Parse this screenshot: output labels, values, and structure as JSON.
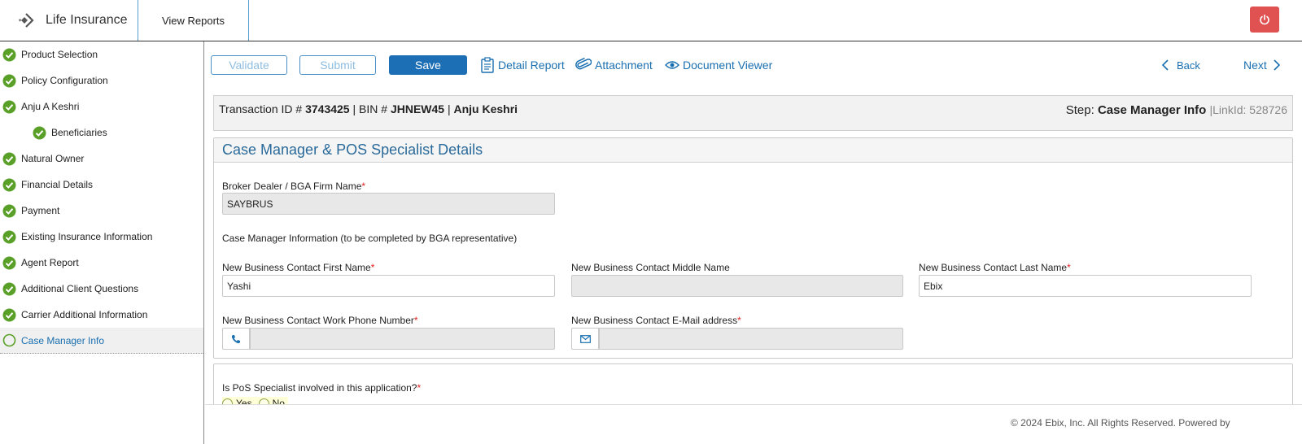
{
  "header": {
    "app_title": "Life Insurance",
    "view_reports": "View Reports"
  },
  "sidebar": {
    "items": [
      {
        "label": "Product Selection",
        "status": "complete"
      },
      {
        "label": "Policy Configuration",
        "status": "complete"
      },
      {
        "label": "Anju A Keshri",
        "status": "complete"
      },
      {
        "label": "Beneficiaries",
        "status": "complete",
        "sub": true
      },
      {
        "label": "Natural Owner",
        "status": "complete"
      },
      {
        "label": "Financial Details",
        "status": "complete"
      },
      {
        "label": "Payment",
        "status": "complete"
      },
      {
        "label": "Existing Insurance Information",
        "status": "complete"
      },
      {
        "label": "Agent Report",
        "status": "complete"
      },
      {
        "label": "Additional Client Questions",
        "status": "complete"
      },
      {
        "label": "Carrier Additional Information",
        "status": "complete"
      },
      {
        "label": "Case Manager Info",
        "status": "current"
      }
    ]
  },
  "toolbar": {
    "validate": "Validate",
    "submit": "Submit",
    "save": "Save",
    "detail_report": "Detail Report",
    "attachment": "Attachment",
    "document_viewer": "Document Viewer",
    "back": "Back",
    "next": "Next"
  },
  "info": {
    "transaction_label": "Transaction ID #",
    "transaction_id": "3743425",
    "bin_label": "BIN #",
    "bin": "JHNEW45",
    "name": "Anju Keshri",
    "step_label": "Step:",
    "step": "Case Manager Info",
    "link_id": "LinkId: 528726"
  },
  "panel": {
    "title": "Case Manager & POS Specialist Details",
    "broker_label": "Broker Dealer / BGA Firm Name",
    "broker_value": "SAYBRUS",
    "case_manager_note": "Case Manager Information (to be completed by BGA representative)",
    "first_name_label": "New Business Contact First Name",
    "first_name_value": "Yashi",
    "middle_name_label": "New Business Contact Middle Name",
    "middle_name_value": "",
    "last_name_label": "New Business Contact Last Name",
    "last_name_value": "Ebix",
    "phone_label": "New Business Contact Work Phone Number",
    "phone_value": "",
    "email_label": "New Business Contact E-Mail address",
    "email_value": ""
  },
  "pos": {
    "question": "Is PoS Specialist involved in this application?",
    "yes": "Yes",
    "no": "No"
  },
  "footer": {
    "text": "© 2024 Ebix, Inc. All Rights Reserved. Powered by"
  },
  "colors": {
    "primary": "#1d6fb5",
    "check_green": "#5aa028",
    "power_red": "#e05252",
    "link_blue": "#1a6fb0"
  }
}
